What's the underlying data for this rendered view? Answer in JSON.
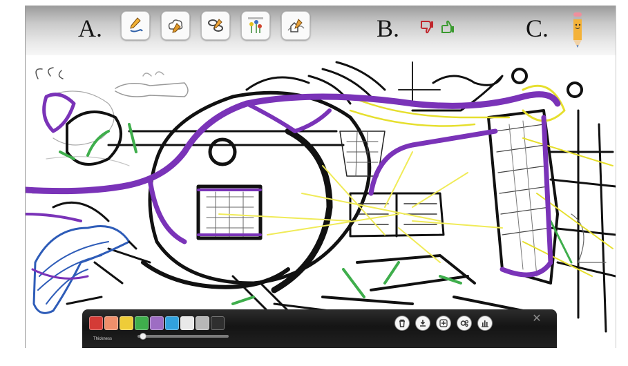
{
  "header": {
    "section_a": "A.",
    "section_b": "B.",
    "section_c": "C.",
    "tools": [
      {
        "icon": "pen-draw-icon"
      },
      {
        "icon": "cloud-pencil-icon"
      },
      {
        "icon": "link-chain-icon"
      },
      {
        "icon": "flowers-scene-icon"
      },
      {
        "icon": "house-landscape-icon"
      }
    ],
    "vote": {
      "dislike_icon": "thumbs-down-icon",
      "like_icon": "thumbs-up-icon",
      "dislike_color": "#c0262d",
      "like_color": "#3a9a2f"
    },
    "pencil_icon": "pencil-icon"
  },
  "toolbar": {
    "colors": [
      "#d43b36",
      "#ef8f6b",
      "#eecc39",
      "#3fae4c",
      "#9d6dc3",
      "#32a2dd",
      "#e9e9e9",
      "#b7b7b7",
      "#2f2f2f"
    ],
    "thickness_label": "Thickness",
    "thickness_level": 0.05,
    "actions": [
      {
        "icon": "trash-icon"
      },
      {
        "icon": "download-icon"
      },
      {
        "icon": "add-icon"
      },
      {
        "icon": "settings-icon"
      },
      {
        "icon": "bar-chart-icon"
      }
    ],
    "close_label": "✕"
  }
}
